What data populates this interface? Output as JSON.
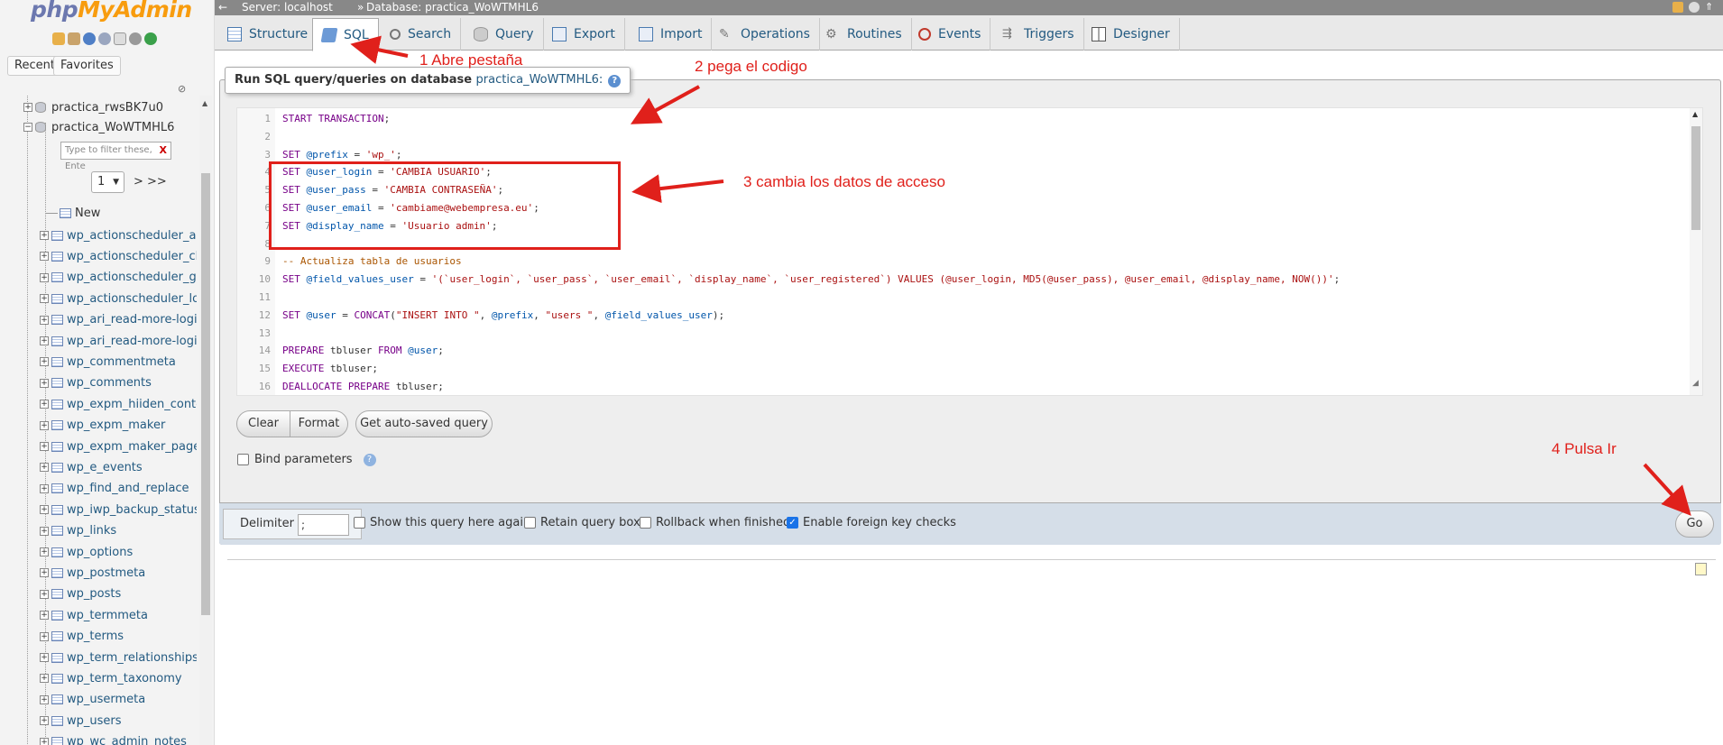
{
  "sidebar": {
    "logo_php": "php",
    "logo_myadmin": "MyAdmin",
    "recent_label": "Recent",
    "favorites_label": "Favorites",
    "collapse_icon": "link-chain-icon",
    "db_items": [
      {
        "label": "practica_rwsBK7u0",
        "state": "collapsed"
      },
      {
        "label": "practica_WoWTMHL6",
        "state": "expanded"
      }
    ],
    "filter_placeholder": "Type to filter these, Ente",
    "filter_clear": "X",
    "pager_value": "1",
    "pager_next": "> >>",
    "new_label": "New",
    "tables": [
      "wp_actionscheduler_ac",
      "wp_actionscheduler_cl",
      "wp_actionscheduler_gr",
      "wp_actionscheduler_lo",
      "wp_ari_read-more-logi",
      "wp_ari_read-more-logi",
      "wp_commentmeta",
      "wp_comments",
      "wp_expm_hiiden_conte",
      "wp_expm_maker",
      "wp_expm_maker_page",
      "wp_e_events",
      "wp_find_and_replace",
      "wp_iwp_backup_status",
      "wp_links",
      "wp_options",
      "wp_postmeta",
      "wp_posts",
      "wp_termmeta",
      "wp_terms",
      "wp_term_relationships",
      "wp_term_taxonomy",
      "wp_usermeta",
      "wp_users",
      "wp_wc_admin_notes"
    ]
  },
  "topbar": {
    "server": "Server: localhost",
    "database": "Database: practica_WoWTMHL6"
  },
  "tabs": [
    {
      "label": "Structure",
      "icon": "structure-icon"
    },
    {
      "label": "SQL",
      "icon": "sql-icon",
      "active": true
    },
    {
      "label": "Search",
      "icon": "search-icon"
    },
    {
      "label": "Query",
      "icon": "query-icon"
    },
    {
      "label": "Export",
      "icon": "export-icon"
    },
    {
      "label": "Import",
      "icon": "import-icon"
    },
    {
      "label": "Operations",
      "icon": "wrench-icon"
    },
    {
      "label": "Routines",
      "icon": "routines-icon"
    },
    {
      "label": "Events",
      "icon": "clock-icon"
    },
    {
      "label": "Triggers",
      "icon": "triggers-icon"
    },
    {
      "label": "Designer",
      "icon": "designer-icon"
    }
  ],
  "sql_panel": {
    "legend_prefix": "Run SQL query/queries on database ",
    "legend_db": "practica_WoWTMHL6:",
    "lines": [
      "START TRANSACTION;",
      "",
      "SET @prefix = 'wp_';",
      "SET @user_login = 'CAMBIA USUARIO';",
      "SET @user_pass = 'CAMBIA CONTRASEÑA';",
      "SET @user_email = 'cambiame@webempresa.eu';",
      "SET @display_name = 'Usuario admin';",
      "",
      "-- Actualiza tabla de usuarios",
      "SET @field_values_user = '(`user_login`, `user_pass`, `user_email`, `display_name`, `user_registered`) VALUES (@user_login, MD5(@user_pass), @user_email, @display_name, NOW())';",
      "",
      "SET @user = CONCAT(\"INSERT INTO \", @prefix, \"users \", @field_values_user);",
      "",
      "PREPARE tbluser FROM @user;",
      "EXECUTE tbluser;",
      "DEALLOCATE PREPARE tbluser;"
    ],
    "clear_label": "Clear",
    "format_label": "Format",
    "autosave_label": "Get auto-saved query",
    "bind_label": "Bind parameters",
    "delimiter_label": "Delimiter",
    "delimiter_value": ";",
    "show_query_label": "Show this query here again",
    "retain_label": "Retain query box",
    "rollback_label": "Rollback when finished",
    "fk_label": "Enable foreign key checks",
    "fk_checked": true,
    "go_label": "Go"
  },
  "annotations": [
    "1 Abre pestaña",
    "2 pega el codigo",
    "3 cambia los datos de acceso",
    "4 Pulsa Ir"
  ],
  "colors": {
    "annotation_red": "#e0201b",
    "link_blue": "#235a81",
    "sql_keyword": "#770088",
    "sql_variable": "#0055aa",
    "sql_string": "#aa1111",
    "sql_comment": "#aa5500"
  }
}
